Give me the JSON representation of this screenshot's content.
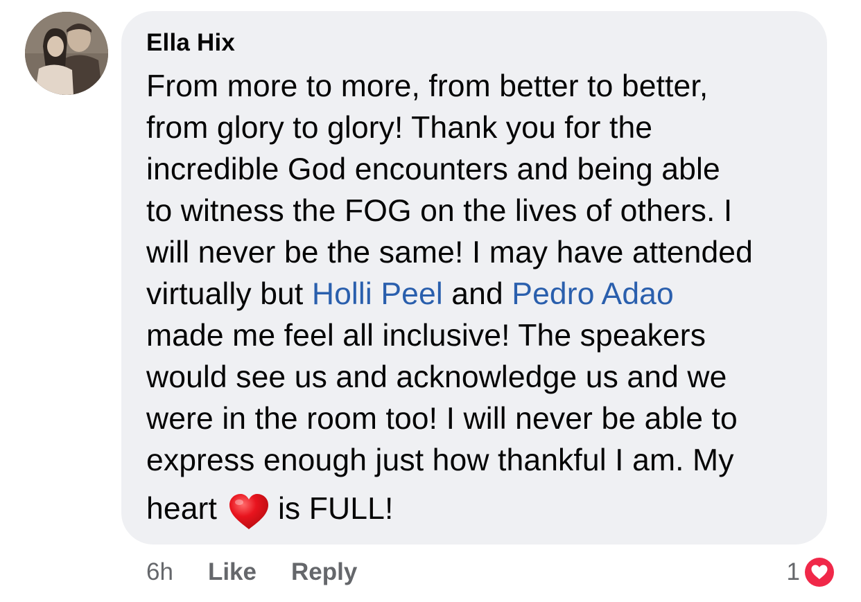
{
  "comment": {
    "author": "Ella Hix",
    "avatar_icon": "profile-photo",
    "lines": [
      "From more to more, from better to better,",
      "from glory to glory! Thank you for the",
      "incredible God encounters and being able",
      "to witness the FOG on the lives of others. I",
      "will never be the same! I may have attended"
    ],
    "mention_line": {
      "before": "virtually but ",
      "mention1": "Holli Peel",
      "middle": " and ",
      "mention2": "Pedro Adao"
    },
    "lines_after": [
      "made me feel all inclusive! The speakers",
      "would see us and acknowledge us and we",
      "were in the room too! I will never be able to",
      "express enough just how thankful I am. My"
    ],
    "last_line": {
      "before": "heart",
      "emoji": "red-heart-emoji",
      "after": "is FULL!"
    },
    "mention_color": "#2a5fad"
  },
  "actions": {
    "time": "6h",
    "like_label": "Like",
    "reply_label": "Reply"
  },
  "reactions": {
    "count": "1",
    "type": "love-icon",
    "color": "#f02849"
  }
}
